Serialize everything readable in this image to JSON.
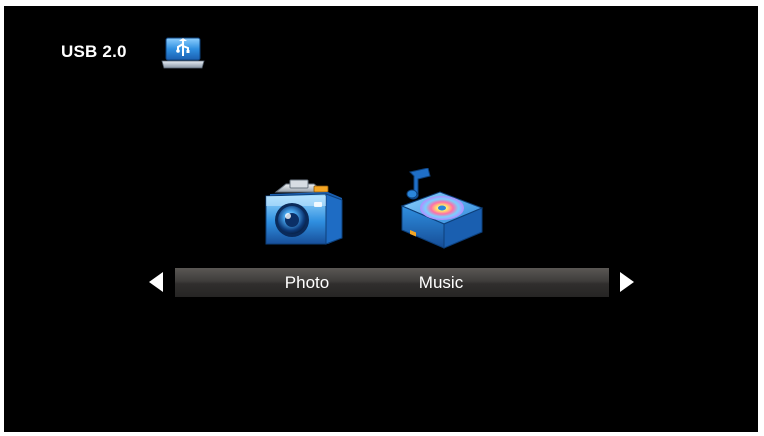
{
  "header": {
    "source_label": "USB 2.0",
    "source_icon": "usb-drive-icon"
  },
  "media_menu": {
    "items": [
      {
        "label": "Photo",
        "icon": "camera-icon"
      },
      {
        "label": "Music",
        "icon": "music-box-icon"
      }
    ],
    "prev_icon": "arrow-left-icon",
    "next_icon": "arrow-right-icon"
  },
  "colors": {
    "background": "#000000",
    "text": "#ffffff",
    "bar_top": "#5a5754",
    "bar_bottom": "#262524",
    "icon_blue": "#2e8fe0"
  }
}
